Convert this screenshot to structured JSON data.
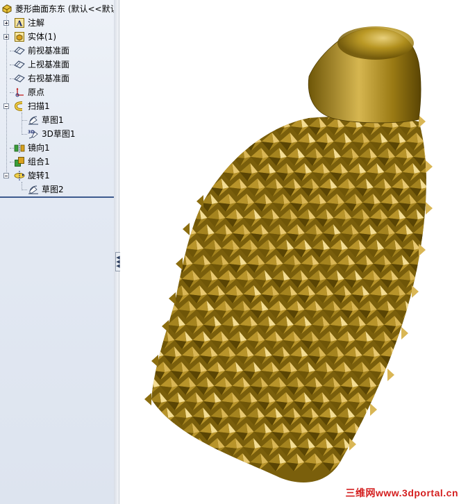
{
  "feature_tree": {
    "root": {
      "label": "菱形曲面东东 (默认<<默认",
      "icon": "part-icon"
    },
    "items": [
      {
        "label": "注解",
        "icon": "annotations-icon"
      },
      {
        "label": "实体(1)",
        "icon": "solid-bodies-icon"
      },
      {
        "label": "前视基准面",
        "icon": "plane-icon"
      },
      {
        "label": "上视基准面",
        "icon": "plane-icon"
      },
      {
        "label": "右视基准面",
        "icon": "plane-icon"
      },
      {
        "label": "原点",
        "icon": "origin-icon"
      },
      {
        "label": "扫描1",
        "icon": "sweep-icon"
      },
      {
        "label": "草图1",
        "icon": "sketch-icon"
      },
      {
        "label": "3D草图1",
        "icon": "3d-sketch-icon"
      },
      {
        "label": "镜向1",
        "icon": "mirror-icon"
      },
      {
        "label": "组合1",
        "icon": "combine-icon"
      },
      {
        "label": "旋转1",
        "icon": "revolve-icon"
      },
      {
        "label": "草图2",
        "icon": "sketch-icon"
      }
    ]
  },
  "viewport": {
    "model_color": "#a88a1e",
    "watermark": "三维网www.3dportal.cn"
  },
  "colors": {
    "panel_bg": "#e3e9f3",
    "rollback_bar": "#3c5a8e",
    "watermark": "#d41e1e"
  }
}
